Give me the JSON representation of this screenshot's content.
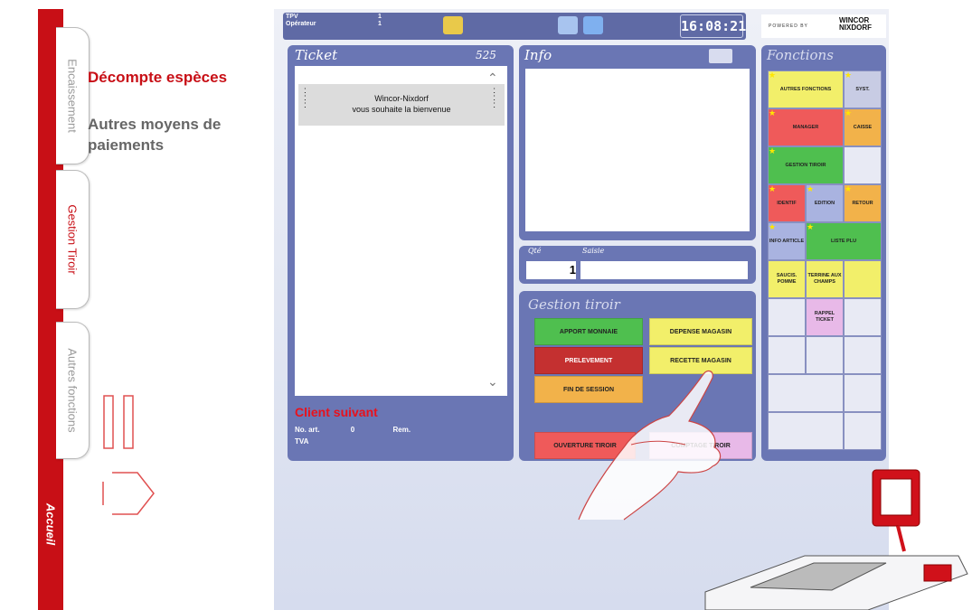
{
  "left_menu": {
    "tabs": [
      {
        "label": "Encaissement"
      },
      {
        "label": "Gestion Tiroir"
      },
      {
        "label": "Autres fonctions"
      }
    ],
    "home_label": "Accueil",
    "items": [
      "Décompte espèces",
      "Autres moyens de paiements"
    ]
  },
  "pos": {
    "header": {
      "labels": [
        "TPV",
        "Opérateur"
      ],
      "values": [
        "1",
        "1"
      ],
      "clock": "16:08:21",
      "powered_by": "POWERED BY",
      "brand": "WINCOR NIXDORF"
    },
    "ticket": {
      "title": "Ticket",
      "number": "525",
      "welcome": [
        "Wincor-Nixdorf",
        "vous souhaite la bienvenue"
      ],
      "client_next": "Client suivant",
      "client_fields": [
        "No. art.",
        "0",
        "Rem.",
        "TVA"
      ]
    },
    "info": {
      "title": "Info"
    },
    "qty": {
      "labels": [
        "Qté",
        "Saisie"
      ],
      "value": "1"
    },
    "gestion_tiroir": {
      "title": "Gestion tiroir",
      "buttons": {
        "apport": "APPORT MONNAIE",
        "depense": "DEPENSE MAGASIN",
        "prelevement": "PRELEVEMENT",
        "recette": "RECETTE MAGASIN",
        "fin": "FIN DE SESSION",
        "ouverture": "OUVERTURE TIROIR",
        "comptage": "COMPTAGE TIROIR"
      }
    },
    "fonctions": {
      "title": "Fonctions",
      "buttons": {
        "autres": "AUTRES FONCTIONS",
        "syst": "SYST.",
        "manager": "MANAGER",
        "caisse": "CAISSE",
        "gestion": "GESTION TIROIR",
        "identif": "IDENTIF",
        "edition": "EDITION",
        "retour": "RETOUR",
        "info_article": "INFO ARTICLE",
        "liste_plu": "LISTE PLU",
        "saucis": "SAUCIS. POMME",
        "terrine": "TERRINE AUX CHAMPS",
        "rappel": "RAPPEL TICKET"
      }
    }
  },
  "colors": {
    "brand_red": "#c80f16",
    "panel_blue": "#6a76b4",
    "btn_green": "#4fbf4f",
    "btn_yellow": "#f2ef6a",
    "btn_red": "#c43030",
    "btn_orange": "#f2b24a",
    "btn_pink": "#e8b9e8",
    "btn_salmon": "#ef5a5a"
  }
}
